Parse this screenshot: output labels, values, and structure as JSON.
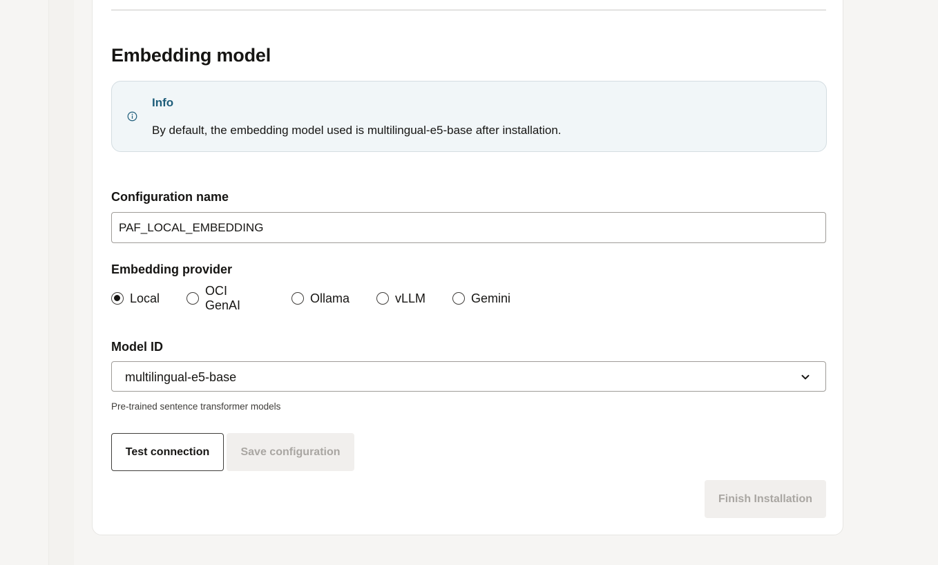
{
  "section": {
    "title": "Embedding model"
  },
  "info": {
    "title": "Info",
    "text": "By default, the embedding model used is multilingual-e5-base after installation.",
    "icon": "info-circle-icon"
  },
  "config_name": {
    "label": "Configuration name",
    "value": "PAF_LOCAL_EMBEDDING"
  },
  "provider": {
    "label": "Embedding provider",
    "selected": "Local",
    "options": [
      "Local",
      "OCI GenAI",
      "Ollama",
      "vLLM",
      "Gemini"
    ]
  },
  "model": {
    "label": "Model ID",
    "selected": "multilingual-e5-base",
    "helper": "Pre-trained sentence transformer models",
    "icon": "chevron-down-icon"
  },
  "buttons": {
    "test": "Test connection",
    "save": "Save configuration",
    "finish": "Finish Installation"
  },
  "colors": {
    "info_title": "#1e5d7a",
    "info_bg": "#f1f6f8",
    "disabled_bg": "#f1efed",
    "disabled_text": "#a9a6a2"
  }
}
